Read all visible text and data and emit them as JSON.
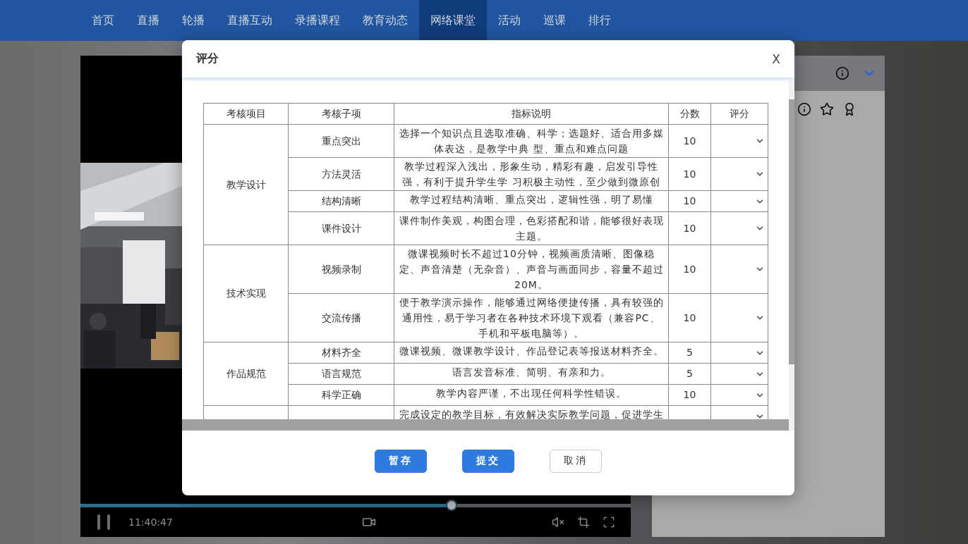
{
  "nav": {
    "items": [
      {
        "label": "首页",
        "selected": false
      },
      {
        "label": "直播",
        "selected": false
      },
      {
        "label": "轮播",
        "selected": false
      },
      {
        "label": "直播互动",
        "selected": false
      },
      {
        "label": "录播课程",
        "selected": false
      },
      {
        "label": "教育动态",
        "selected": false
      },
      {
        "label": "网络课堂",
        "selected": true
      },
      {
        "label": "活动",
        "selected": false
      },
      {
        "label": "巡课",
        "selected": false
      },
      {
        "label": "排行",
        "selected": false
      }
    ]
  },
  "player": {
    "time": "11:40:47",
    "progress": {
      "level": 0.674
    }
  },
  "dialog": {
    "title": "评分",
    "close": "X",
    "table": {
      "columns": [
        "考核项目",
        "考核子项",
        "指标说明",
        "分数",
        "评分"
      ],
      "groups": [
        {
          "category": "教学设计",
          "items": [
            {
              "name": "重点突出",
              "description": "选择一个知识点且选取准确、科学；选题好、适合用多媒体表达，是教学中典 型、重点和难点问题",
              "score": "10"
            },
            {
              "name": "方法灵活",
              "description": "教学过程深入浅出，形象生动，精彩有趣，启发引导性强，有利于提升学生学 习积极主动性，至少做到微原创",
              "score": "10"
            },
            {
              "name": "结构清晰",
              "description": "教学过程结构清晰、重点突出，逻辑性强，明了易懂",
              "score": "10"
            },
            {
              "name": "课件设计",
              "description": "课件制作美观，构图合理，色彩搭配和谐，能够很好表现主题。",
              "score": "10"
            }
          ]
        },
        {
          "category": "技术实现",
          "items": [
            {
              "name": "视频录制",
              "description": "微课视频时长不超过10分钟，视频画质清晰、图像稳定、声音清楚（无杂音）、声音与画面同步，容量不超过20M。",
              "score": "10"
            },
            {
              "name": "交流传播",
              "description": "便于教学演示操作，能够通过网络便捷传播，具有较强的通用性，易于学习者在各种技术环境下观看（兼容PC、手机和平板电脑等）。",
              "score": "10"
            }
          ]
        },
        {
          "category": "作品规范",
          "items": [
            {
              "name": "材料齐全",
              "description": "微课视频、微课教学设计、作品登记表等报送材料齐全。",
              "score": "5"
            },
            {
              "name": "语言规范",
              "description": "语言发音标准、简明、有亲和力。",
              "score": "5"
            },
            {
              "name": "科学正确",
              "description": "教学内容严谨，不出现任何科学性错误。",
              "score": "10"
            }
          ]
        },
        {
          "items": [
            {
              "description": "完成设定的教学目标，有效解决实际教学问题，促进学生"
            }
          ]
        }
      ]
    },
    "buttons": [
      {
        "label": "暂存",
        "kind": "primary"
      },
      {
        "label": "提交",
        "kind": "primary"
      },
      {
        "label": "取消",
        "kind": "secondary"
      }
    ]
  }
}
